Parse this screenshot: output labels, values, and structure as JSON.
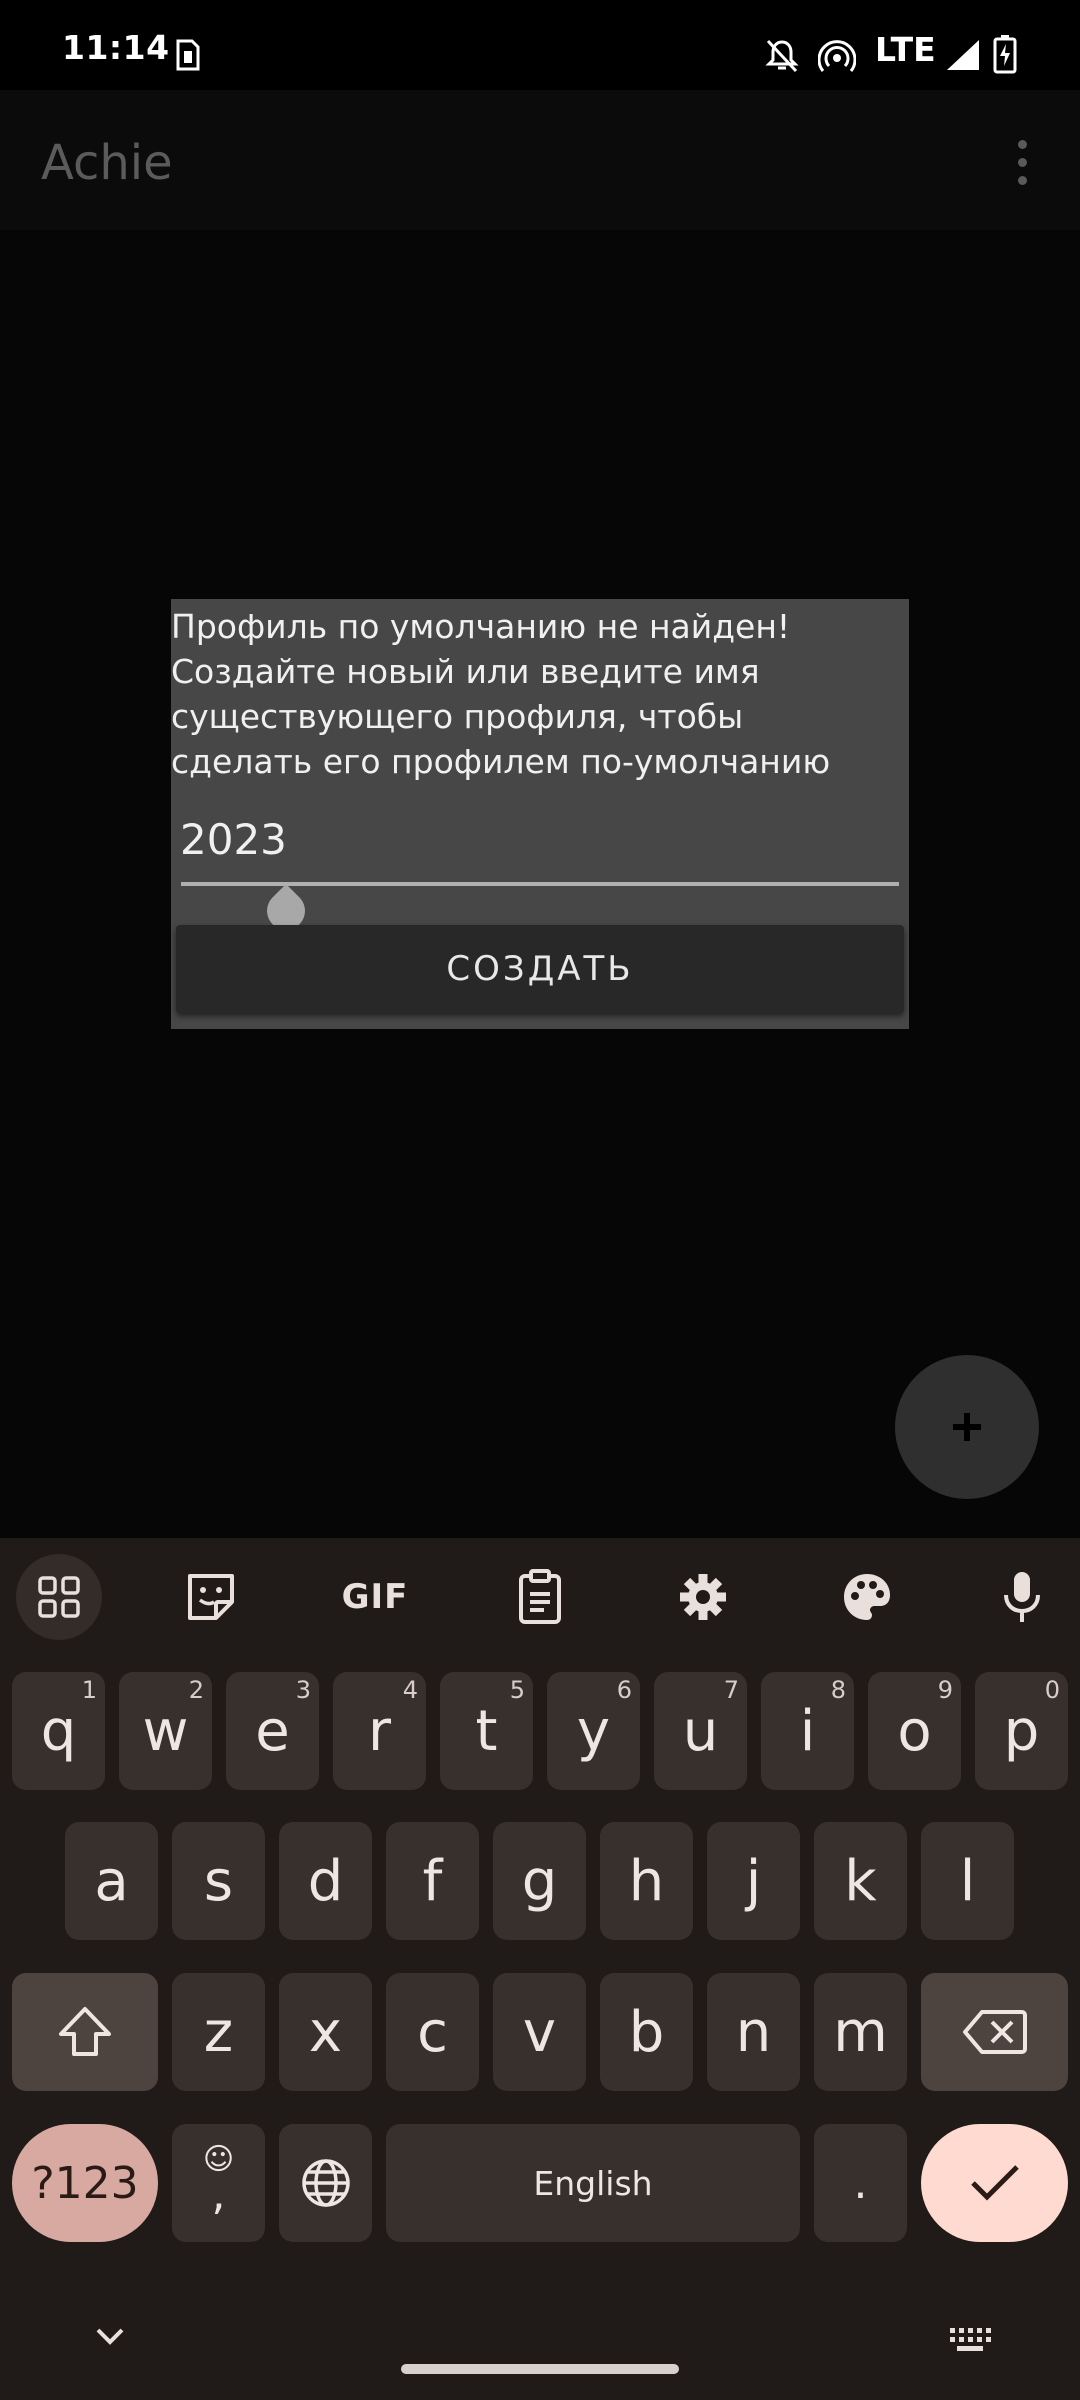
{
  "status_bar": {
    "time": "11:14",
    "network": "LTE",
    "icons": [
      "sim-card-icon",
      "notifications-off-icon",
      "hotspot-icon",
      "signal-icon",
      "battery-charging-icon"
    ]
  },
  "app": {
    "title": "Achie",
    "overflow_icon": "more-vert-icon"
  },
  "dialog": {
    "message": "Профиль по умолчанию не найден! Создайте новый или введите имя существующего профиля, чтобы сделать его профилем по-умолчанию",
    "input_value": "2023",
    "button_label": "СОЗДАТЬ"
  },
  "fab": {
    "icon": "plus-icon"
  },
  "keyboard": {
    "toolbar": {
      "icons": [
        "apps-grid-icon",
        "sticker-icon",
        "gif-icon",
        "clipboard-icon",
        "settings-gear-icon",
        "palette-icon",
        "microphone-icon"
      ],
      "gif_label": "GIF"
    },
    "row1": [
      {
        "key": "q",
        "num": "1"
      },
      {
        "key": "w",
        "num": "2"
      },
      {
        "key": "e",
        "num": "3"
      },
      {
        "key": "r",
        "num": "4"
      },
      {
        "key": "t",
        "num": "5"
      },
      {
        "key": "y",
        "num": "6"
      },
      {
        "key": "u",
        "num": "7"
      },
      {
        "key": "i",
        "num": "8"
      },
      {
        "key": "o",
        "num": "9"
      },
      {
        "key": "p",
        "num": "0"
      }
    ],
    "row2": [
      "a",
      "s",
      "d",
      "f",
      "g",
      "h",
      "j",
      "k",
      "l"
    ],
    "row3": [
      "z",
      "x",
      "c",
      "v",
      "b",
      "n",
      "m"
    ],
    "symbols_label": "?123",
    "comma_label": ",",
    "space_label": "English",
    "period_label": ".",
    "bottom_icons": [
      "chevron-down-icon",
      "keyboard-icon"
    ]
  },
  "colors": {
    "keyboard_bg": "#201b19",
    "key_bg": "#37302c",
    "symbols_key": "#d8a9a0",
    "enter_key": "#ffdad1",
    "dialog_bg": "#474747"
  }
}
